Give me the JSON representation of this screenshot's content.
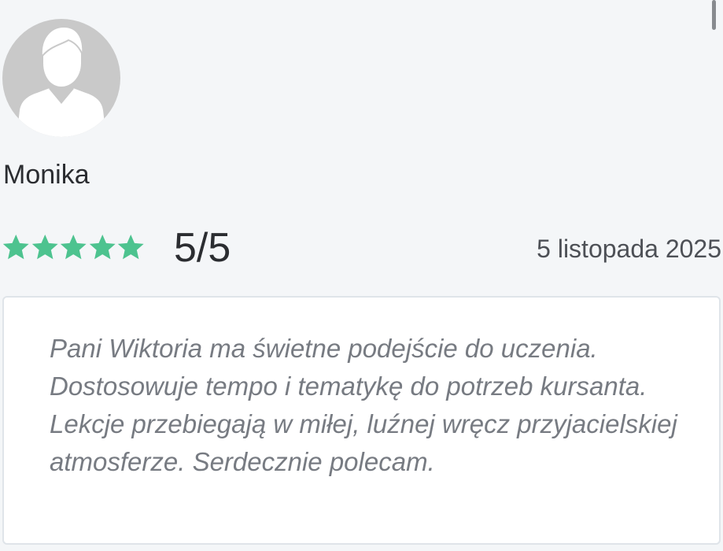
{
  "review": {
    "reviewer_name": "Monika",
    "rating_text": "5/5",
    "rating_value": 5,
    "rating_max": 5,
    "date": "5 listopada 2025",
    "text": "Pani Wiktoria ma świetne podejście do uczenia. Dostosowuje tempo i tematykę do potrzeb kursanta. Lekcje przebiegają w miłej, luźnej wręcz przyjacielskiej atmosferze. Serdecznie polecam."
  },
  "colors": {
    "star": "#4dc38f",
    "avatar_bg": "#c9c9c9",
    "page_bg": "#f4f6f8"
  },
  "icons": {
    "avatar": "user-silhouette-icon",
    "star": "star-icon"
  }
}
